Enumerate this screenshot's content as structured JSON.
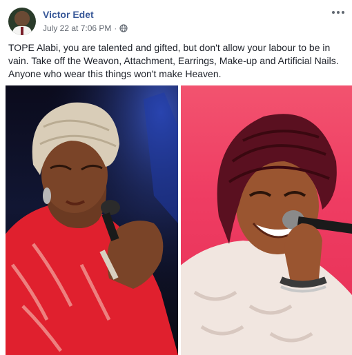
{
  "author": {
    "name": "Victor Edet",
    "timestamp": "July 22 at 7:06 PM",
    "separator": "·",
    "privacy_icon": "globe-icon"
  },
  "menu": {
    "icon": "more-options-icon"
  },
  "post": {
    "text": "TOPE Alabi, you are talented and gifted, but don't allow your labour to be in vain. Take off the Weavon, Attachment, Earrings, Make-up and Artificial Nails. Anyone who wear this things won't make Heaven."
  },
  "photos": [
    {
      "subject": "singer-in-red-lace-with-cream-headwrap"
    },
    {
      "subject": "smiling-singer-in-white-lace-with-maroon-headwrap"
    }
  ],
  "colors": {
    "name_link": "#385898",
    "meta_text": "#616770",
    "body_text": "#1d2129"
  }
}
